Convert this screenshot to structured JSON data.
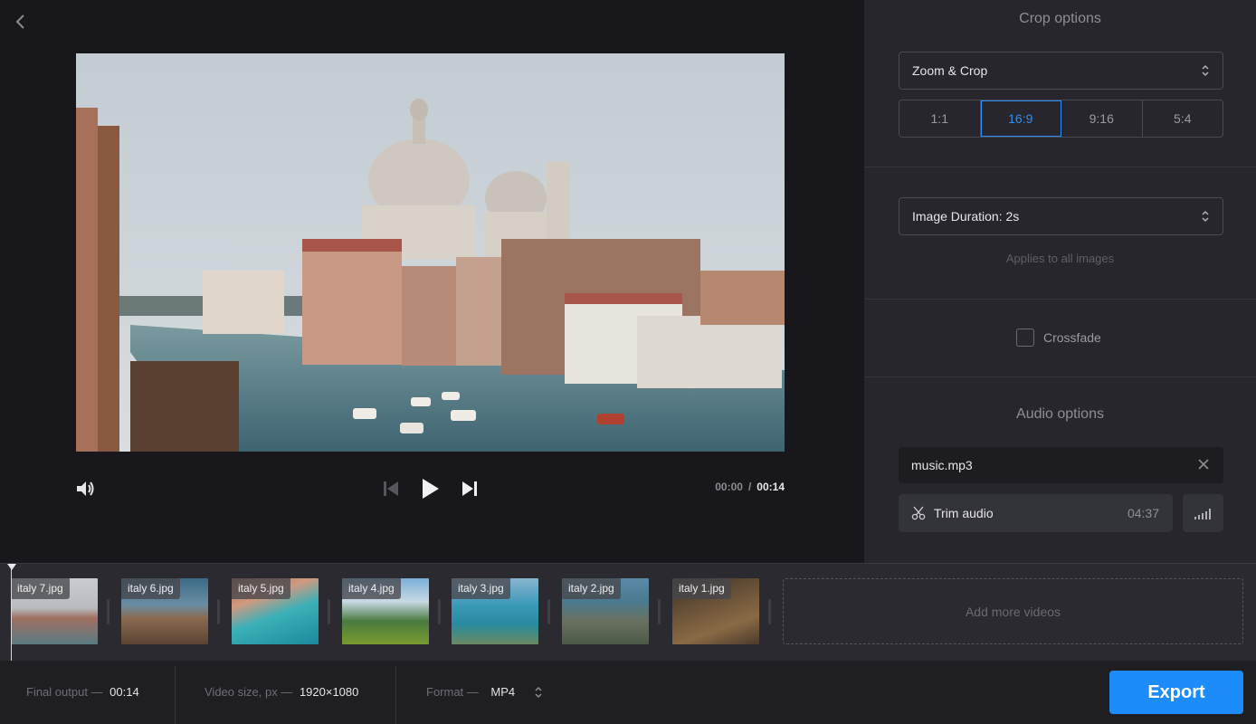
{
  "preview": {
    "time_current": "00:00",
    "time_separator": "/",
    "time_total": "00:14"
  },
  "crop": {
    "title": "Crop options",
    "mode": "Zoom & Crop",
    "ratios": [
      "1:1",
      "16:9",
      "9:16",
      "5:4"
    ],
    "selected_ratio": "16:9"
  },
  "duration": {
    "value": "Image Duration: 2s",
    "note": "Applies to all images"
  },
  "crossfade": {
    "label": "Crossfade",
    "checked": false
  },
  "audio": {
    "title": "Audio options",
    "file": "music.mp3",
    "trim_label": "Trim audio",
    "trim_duration": "04:37"
  },
  "timeline": {
    "clips": [
      "italy 7.jpg",
      "italy 6.jpg",
      "italy 5.jpg",
      "italy 4.jpg",
      "italy 3.jpg",
      "italy 2.jpg",
      "italy 1.jpg"
    ],
    "add_more": "Add more videos"
  },
  "footer": {
    "final_output_label": "Final output —",
    "final_output_value": "00:14",
    "video_size_label": "Video size, px —",
    "video_size_value": "1920×1080",
    "format_label": "Format —",
    "format_value": "MP4",
    "export_label": "Export"
  },
  "colors": {
    "accent": "#1c8cf8",
    "panel": "#26262c",
    "preview_bg": "#17171c"
  }
}
